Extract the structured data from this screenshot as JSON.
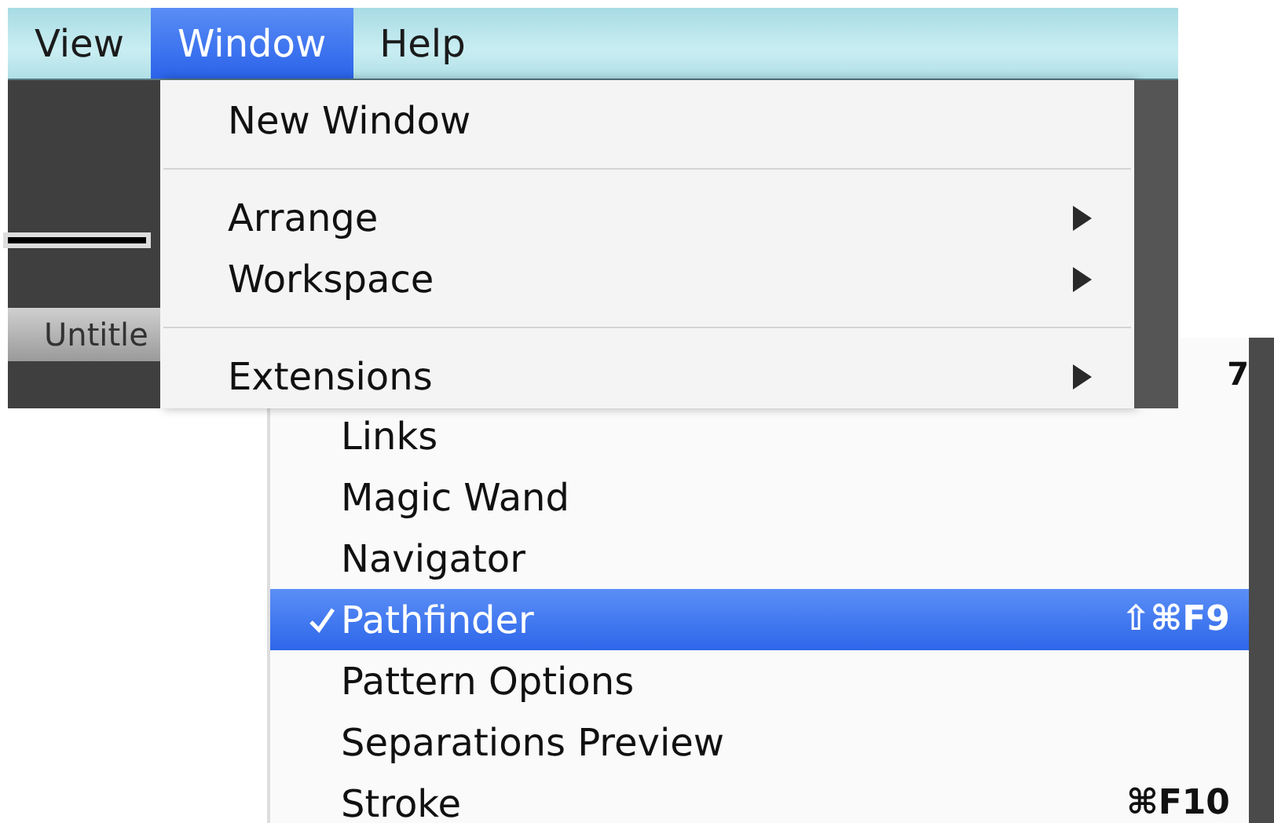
{
  "menu_bar": [
    {
      "label": "View",
      "selected": false
    },
    {
      "label": "Window",
      "selected": true
    },
    {
      "label": "Help",
      "selected": false
    }
  ],
  "window_menu": [
    {
      "kind": "item",
      "label": "New Window"
    },
    {
      "kind": "separator"
    },
    {
      "kind": "submenu",
      "label": "Arrange"
    },
    {
      "kind": "submenu",
      "label": "Workspace"
    },
    {
      "kind": "separator"
    },
    {
      "kind": "submenu",
      "label": "Extensions"
    }
  ],
  "document_tab": {
    "title": "Untitle"
  },
  "lower_menu": {
    "cut_shortcut": "7",
    "items": [
      {
        "label": "Links",
        "checked": false,
        "selected": false
      },
      {
        "label": "Magic Wand",
        "checked": false,
        "selected": false
      },
      {
        "label": "Navigator",
        "checked": false,
        "selected": false
      },
      {
        "label": "Pathfinder",
        "checked": true,
        "selected": true,
        "shortcut": "⇧⌘F9"
      },
      {
        "label": "Pattern Options",
        "checked": false,
        "selected": false
      },
      {
        "label": "Separations Preview",
        "checked": false,
        "selected": false
      },
      {
        "label": "Stroke",
        "checked": false,
        "selected": false,
        "shortcut": "⌘F10"
      }
    ]
  }
}
